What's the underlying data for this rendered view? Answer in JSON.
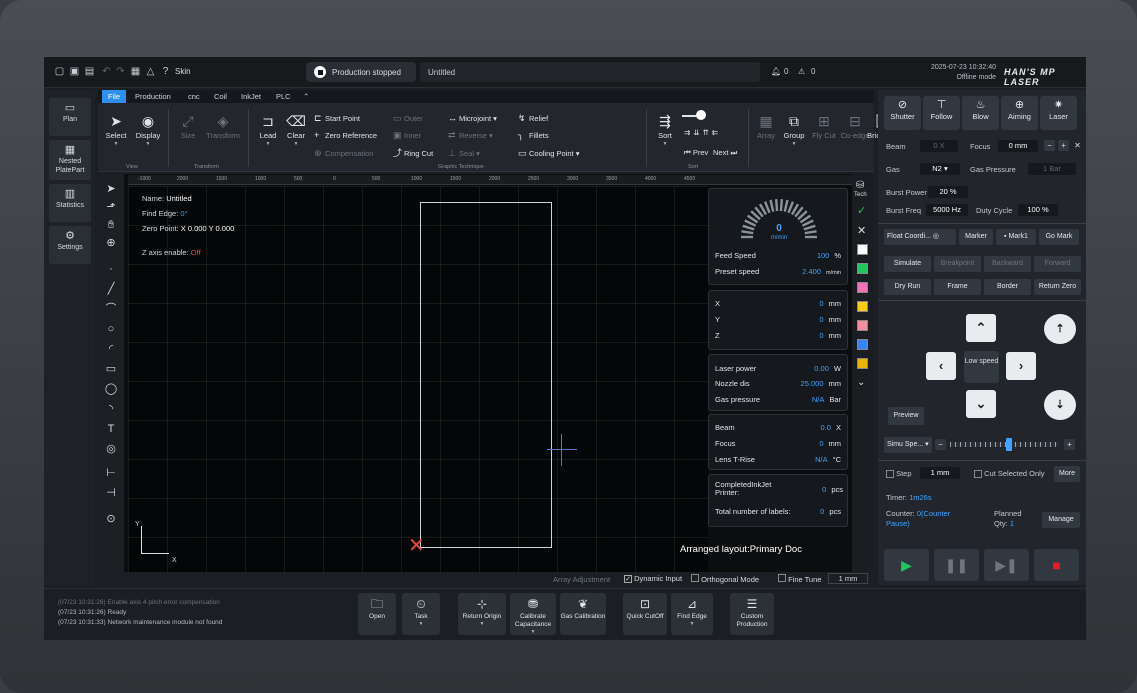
{
  "topbar": {
    "skin_label": "Skin",
    "status": "Production stopped",
    "doc_title": "Untitled",
    "alarm_count": "0",
    "warn_count": "0",
    "datetime": "2025-07-23 10:32:40",
    "mode": "Offline mode",
    "brand": "HAN'S MP LASER"
  },
  "sidebar": {
    "items": [
      {
        "label": "Plan",
        "icon": "plan-icon"
      },
      {
        "label": "Nested PlatePart",
        "icon": "nested-icon"
      },
      {
        "label": "Statistics",
        "icon": "statistics-icon"
      },
      {
        "label": "Settings",
        "icon": "settings-icon"
      }
    ]
  },
  "ribbon": {
    "tabs": [
      "File",
      "Production",
      "cnc",
      "Coil",
      "InkJet",
      "PLC"
    ],
    "active_tab": "File",
    "select": "Select",
    "display": "Display",
    "size": "Size",
    "transform": "Transform",
    "lead": "Lead",
    "clear": "Clear",
    "start_point": "Start Point",
    "zero_reference": "Zero Reference",
    "compensation": "Compensation",
    "outer": "Outer",
    "inner": "Inner",
    "microjoint": "Microjoint",
    "reverse": "Reverse",
    "seal": "Seal",
    "ring_cut": "Ring Cut",
    "relief": "Relief",
    "fillets": "Fillets",
    "cooling_point": "Cooling Point",
    "sort": "Sort",
    "prev": "Prev",
    "next": "Next",
    "array": "Array",
    "group": "Group",
    "fly_cut": "Fly Cut",
    "co_edge": "Co-edge",
    "bridge": "Bridge",
    "group_view": "View",
    "group_transform": "Transform",
    "group_graphic": "Graphic Technique",
    "group_sort": "Sort"
  },
  "canvas": {
    "name_label": "Name:",
    "name": "Untitled",
    "find_edge_label": "Find Edge:",
    "find_edge": "0°",
    "zero_point_label": "Zero Point:",
    "zero_point": "X 0.000 Y 0.000",
    "z_axis_label": "Z axis enable:",
    "z_axis": "Off",
    "axis_x": "X",
    "axis_y": "Y",
    "layout_label": "Arranged layout:Primary Doc",
    "ruler_ticks": [
      "-1000",
      "2000",
      "1500",
      "1000",
      "500",
      "0",
      "500",
      "1000",
      "1500",
      "2000",
      "2500",
      "3000",
      "3500",
      "4000",
      "4500"
    ]
  },
  "info": {
    "speed_value": "0",
    "speed_unit": "m/min",
    "feed_speed_label": "Feed Speed",
    "feed_speed": "100",
    "feed_speed_unit": "%",
    "preset_speed_label": "Preset speed",
    "preset_speed": "2.400",
    "preset_speed_unit": "m/min",
    "x_label": "X",
    "x": "0",
    "y_label": "Y",
    "y": "0",
    "z_label": "Z",
    "z": "0",
    "mm": "mm",
    "laser_power_label": "Laser power",
    "laser_power": "0.00",
    "laser_power_unit": "W",
    "nozzle_label": "Nozzle dis",
    "nozzle": "25.000",
    "nozzle_unit": "mm",
    "gas_pressure_label": "Gas pressure",
    "gas_pressure": "N/A",
    "gas_pressure_unit": "Bar",
    "beam_label": "Beam",
    "beam": "0.0",
    "beam_unit": "X",
    "focus_label": "Focus",
    "focus": "0",
    "focus_unit": "mm",
    "lens_label": "Lens T-Rise",
    "lens": "N/A",
    "lens_unit": "°C",
    "completed_label": "CompletedInkJet Printer:",
    "completed": "0",
    "pcs": "pcs",
    "total_label": "Total number of labels:",
    "total": "0"
  },
  "layers": {
    "tech_label": "Tech",
    "colors": [
      "#ffffff",
      "#22c55e",
      "#f472b6",
      "#facc15",
      "#f48fa0",
      "#3b82f6",
      "#eab308"
    ]
  },
  "statusrow": {
    "array_adjustment": "Array Adjustment",
    "dynamic_input": "Dynamic Input",
    "orthogonal_mode": "Orthogonal Mode",
    "fine_tune": "Fine Tune",
    "step_value": "1 mm"
  },
  "rpanel": {
    "buttons": [
      "Shutter",
      "Follow",
      "Blow",
      "Aiming",
      "Laser"
    ],
    "beam_label": "Beam",
    "beam_value": "0 X",
    "focus_label": "Focus",
    "focus_value": "0 mm",
    "gas_label": "Gas",
    "gas_value": "N2",
    "gas_pressure_label": "Gas Pressure",
    "gas_pressure_value": "1 Bar",
    "burst_power_label": "Burst Power",
    "burst_power": "20 %",
    "burst_freq_label": "Burst Freq",
    "burst_freq": "5000 Hz",
    "duty_label": "Duty Cycle",
    "duty": "100 %",
    "float_coord": "Float Coordi...",
    "marker": "Marker",
    "mark1": "Mark1",
    "go_mark": "Go Mark",
    "simulate": "Simulate",
    "breakpoint": "Breakpoint",
    "backward": "Backward",
    "forward": "Forward",
    "dry_run": "Dry Run",
    "frame": "Frame",
    "border": "Border",
    "return_zero": "Return Zero",
    "low_speed": "Low speed",
    "preview": "Preview",
    "simu_speed": "Simu Spe...",
    "simu_level": 0.55,
    "step_label": "Step",
    "step_value": "1 mm",
    "cut_selected": "Cut Selected Only",
    "more": "More",
    "timer_label": "Timer:",
    "timer": "1m26s",
    "counter_label": "Counter:",
    "counter": "0(Counter Pause)",
    "planned_label": "Planned Qty:",
    "planned": "1",
    "manage": "Manage"
  },
  "bottom": {
    "log": [
      {
        "text": "(07/23 10:31:26) Enable axis 4 pitch error compensation",
        "dim": true
      },
      {
        "text": "(07/23 10:31:26) Ready",
        "dim": false
      },
      {
        "text": "(07/23 10:31:33) Network maintenance module not found",
        "dim": false
      }
    ],
    "buttons": [
      "Open",
      "Task",
      "Return Origin",
      "Calibrate Capacitance",
      "Gas Calibration",
      "Quick CutOff",
      "Find Edge",
      "Custom Production"
    ]
  }
}
